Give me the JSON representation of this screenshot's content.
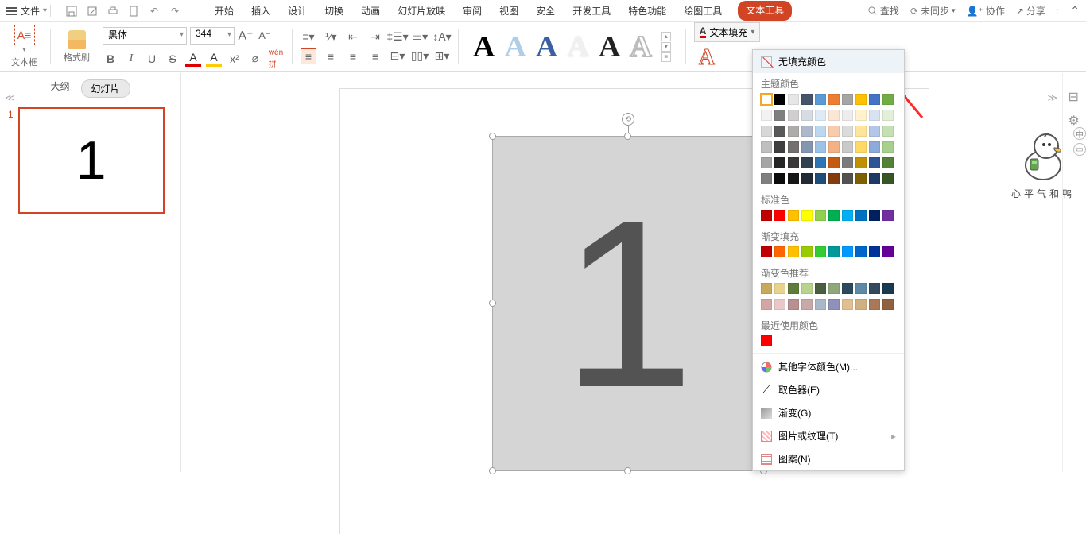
{
  "menubar": {
    "file": "文件",
    "tabs": [
      "开始",
      "插入",
      "设计",
      "切换",
      "动画",
      "幻灯片放映",
      "审阅",
      "视图",
      "安全",
      "开发工具",
      "特色功能",
      "绘图工具",
      "文本工具"
    ],
    "search": "查找",
    "unsync": "未同步",
    "collab": "协作",
    "share": "分享"
  },
  "ribbon": {
    "textbox": "文本框",
    "format_painter": "格式刷",
    "font_name": "黑体",
    "font_size": "344",
    "text_fill": "文本填充"
  },
  "slidepanel": {
    "outline": "大纲",
    "slides": "幻灯片",
    "slide_number": "1",
    "thumb_text": "1"
  },
  "canvas": {
    "text": "1"
  },
  "colorpopup": {
    "no_fill": "无填充颜色",
    "theme_colors": "主题颜色",
    "standard_colors": "标准色",
    "gradient_fill": "渐变填充",
    "gradient_recommend": "渐变色推荐",
    "recent_colors": "最近使用颜色",
    "more_colors": "其他字体颜色(M)...",
    "eyedropper": "取色器(E)",
    "gradient": "渐变(G)",
    "picture": "图片或纹理(T)",
    "pattern": "图案(N)",
    "theme_row1": [
      "#ffffff",
      "#000000",
      "#e7e6e6",
      "#44546a",
      "#5b9bd5",
      "#ed7d31",
      "#a5a5a5",
      "#ffc000",
      "#4472c4",
      "#70ad47"
    ],
    "theme_shades": [
      [
        "#f2f2f2",
        "#7f7f7f",
        "#d0cece",
        "#d6dce4",
        "#deebf6",
        "#fbe5d5",
        "#ededed",
        "#fff2cc",
        "#d9e2f3",
        "#e2efd9"
      ],
      [
        "#d8d8d8",
        "#595959",
        "#aeabab",
        "#adb9ca",
        "#bdd7ee",
        "#f7cbac",
        "#dbdbdb",
        "#fee599",
        "#b4c6e7",
        "#c5e0b3"
      ],
      [
        "#bfbfbf",
        "#3f3f3f",
        "#757070",
        "#8496b0",
        "#9cc3e5",
        "#f4b183",
        "#c9c9c9",
        "#ffd965",
        "#8eaadb",
        "#a8d08d"
      ],
      [
        "#a5a5a5",
        "#262626",
        "#3a3838",
        "#323f4f",
        "#2e75b5",
        "#c55a11",
        "#7b7b7b",
        "#bf9000",
        "#2f5496",
        "#538135"
      ],
      [
        "#7f7f7f",
        "#0c0c0c",
        "#171616",
        "#222a35",
        "#1e4e79",
        "#833c0b",
        "#525252",
        "#7f6000",
        "#1f3864",
        "#375623"
      ]
    ],
    "standard_row": [
      "#c00000",
      "#ff0000",
      "#ffc000",
      "#ffff00",
      "#92d050",
      "#00b050",
      "#00b0f0",
      "#0070c0",
      "#002060",
      "#7030a0"
    ],
    "gradient_row": [
      "#c00000",
      "#ff6600",
      "#ffc000",
      "#99cc00",
      "#33cc33",
      "#009999",
      "#0099ff",
      "#0066cc",
      "#003399",
      "#660099"
    ],
    "gradient_rec": [
      [
        "#c9a959",
        "#e8d28e",
        "#5f7c3b",
        "#b8d48c",
        "#4a5f41",
        "#8fa87a",
        "#2b4a5e",
        "#5d8aa8",
        "#34495e",
        "#1a3a52"
      ],
      [
        "#d4a5a5",
        "#e8c8c8",
        "#b89090",
        "#c8a8a8",
        "#a8b8c8",
        "#9090b8",
        "#e0c090",
        "#d0b080",
        "#a87858",
        "#906040"
      ]
    ],
    "recent_row": [
      "#ff0000"
    ]
  },
  "mascot": {
    "caption": "心平气和鸭"
  }
}
